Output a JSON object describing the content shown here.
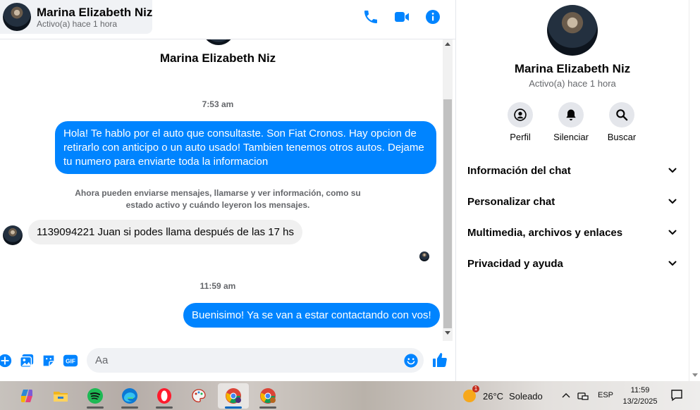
{
  "header": {
    "name": "Marina Elizabeth Niz",
    "status": "Activo(a) hace 1 hora",
    "icons": [
      "phone-icon",
      "video-camera-icon",
      "info-icon"
    ]
  },
  "thread": {
    "name": "Marina Elizabeth Niz",
    "time1": "7:53 am",
    "msg1": "Hola! Te hablo por el auto que consultaste. Son Fiat Cronos. Hay opcion de retirarlo con anticipo o un auto usado! Tambien tenemos otros autos. Dejame tu numero para enviarte toda la informacion",
    "notice": "Ahora pueden enviarse mensajes, llamarse y ver información, como su estado activo y cuándo leyeron los mensajes.",
    "msg2": "1139094221 Juan si podes llama después de las 17 hs",
    "time2": "11:59 am",
    "msg3": "Buenisimo! Ya se van a estar contactando con vos!"
  },
  "composer": {
    "placeholder": "Aa",
    "icons": [
      "plus-icon",
      "photo-icon",
      "sticker-icon",
      "gif-icon",
      "emoji-icon",
      "thumbs-up-icon"
    ],
    "gif_label": "GIF"
  },
  "info_panel": {
    "name": "Marina Elizabeth Niz",
    "status": "Activo(a) hace 1 hora",
    "actions": [
      {
        "label": "Perfil",
        "icon": "profile-icon"
      },
      {
        "label": "Silenciar",
        "icon": "bell-icon"
      },
      {
        "label": "Buscar",
        "icon": "search-icon"
      }
    ],
    "sections": [
      {
        "label": "Información del chat"
      },
      {
        "label": "Personalizar chat"
      },
      {
        "label": "Multimedia, archivos y enlaces"
      },
      {
        "label": "Privacidad y ayuda"
      }
    ]
  },
  "taskbar": {
    "apps": [
      {
        "name": "copilot-icon"
      },
      {
        "name": "file-explorer-icon"
      },
      {
        "name": "spotify-icon"
      },
      {
        "name": "edge-icon"
      },
      {
        "name": "opera-icon"
      },
      {
        "name": "paint-icon"
      },
      {
        "name": "chrome-profile-icon"
      },
      {
        "name": "chrome-icon"
      }
    ],
    "weather_temp": "26°C",
    "weather_text": "Soleado",
    "weather_badge": "1",
    "language": "ESP",
    "time": "11:59",
    "date": "13/2/2025"
  },
  "colors": {
    "accent": "#0084ff",
    "incoming_bubble": "#f0f0f0",
    "secondary_text": "#65676b"
  }
}
